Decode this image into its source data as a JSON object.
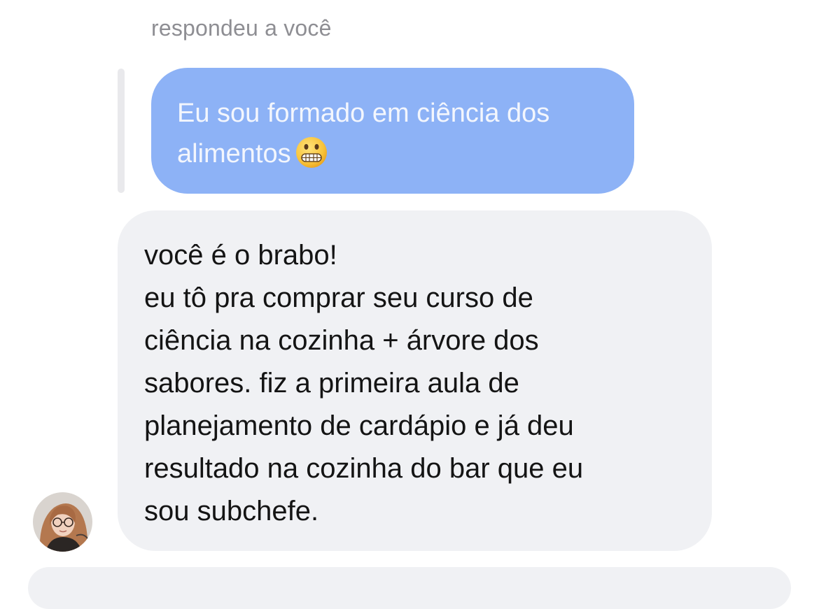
{
  "reply_context": {
    "label": "respondeu a você"
  },
  "quoted_message": {
    "line1": "Eu sou formado em ciência dos",
    "line2": "alimentos",
    "emoji": "grimacing-face-emoji",
    "bubble_color": "#8db2f6"
  },
  "message": {
    "lines": [
      "você é o brabo!",
      "eu tô pra comprar seu curso de",
      "ciência na cozinha + árvore dos",
      "sabores. fiz a primeira aula de",
      "planejamento de cardápio e já deu",
      "resultado na cozinha do bar que eu",
      "sou subchefe."
    ],
    "bubble_color": "#f0f1f4"
  },
  "sender": {
    "avatar": "profile-photo-avatar"
  }
}
